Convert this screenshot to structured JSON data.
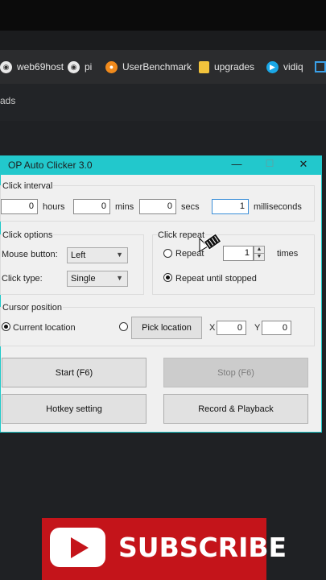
{
  "bookmarks": [
    {
      "label": "web69host",
      "icon": "globe-icon"
    },
    {
      "label": "pi",
      "icon": "globe-icon"
    },
    {
      "label": "UserBenchmark",
      "icon": "userbenchmark-icon"
    },
    {
      "label": "upgrades",
      "icon": "folder-icon"
    },
    {
      "label": "vidiq",
      "icon": "vidiq-icon"
    }
  ],
  "page": {
    "partial_word": "ads"
  },
  "window": {
    "title": "OP Auto Clicker 3.0",
    "minimize": "—",
    "maximize": "☐",
    "close": "✕",
    "click_interval": {
      "label": "Click interval",
      "hours_value": "0",
      "hours_label": "hours",
      "mins_value": "0",
      "mins_label": "mins",
      "secs_value": "0",
      "secs_label": "secs",
      "ms_value": "1",
      "ms_label": "milliseconds"
    },
    "click_options": {
      "label": "Click options",
      "mouse_button_label": "Mouse button:",
      "mouse_button_value": "Left",
      "click_type_label": "Click type:",
      "click_type_value": "Single"
    },
    "click_repeat": {
      "label": "Click repeat",
      "repeat_label": "Repeat",
      "repeat_value": "1",
      "times_label": "times",
      "until_stopped_label": "Repeat until stopped",
      "selected": "until_stopped"
    },
    "cursor_position": {
      "label": "Cursor position",
      "current_label": "Current location",
      "pick_label": "Pick location",
      "x_label": "X",
      "x_value": "0",
      "y_label": "Y",
      "y_value": "0",
      "selected": "current"
    },
    "buttons": {
      "start": "Start (F6)",
      "stop": "Stop (F6)",
      "hotkey": "Hotkey setting",
      "record": "Record & Playback"
    }
  },
  "subscribe": {
    "label": "SUBSCRIBE"
  },
  "colors": {
    "title_bar": "#22c8cc",
    "youtube_red": "#c4141a"
  }
}
